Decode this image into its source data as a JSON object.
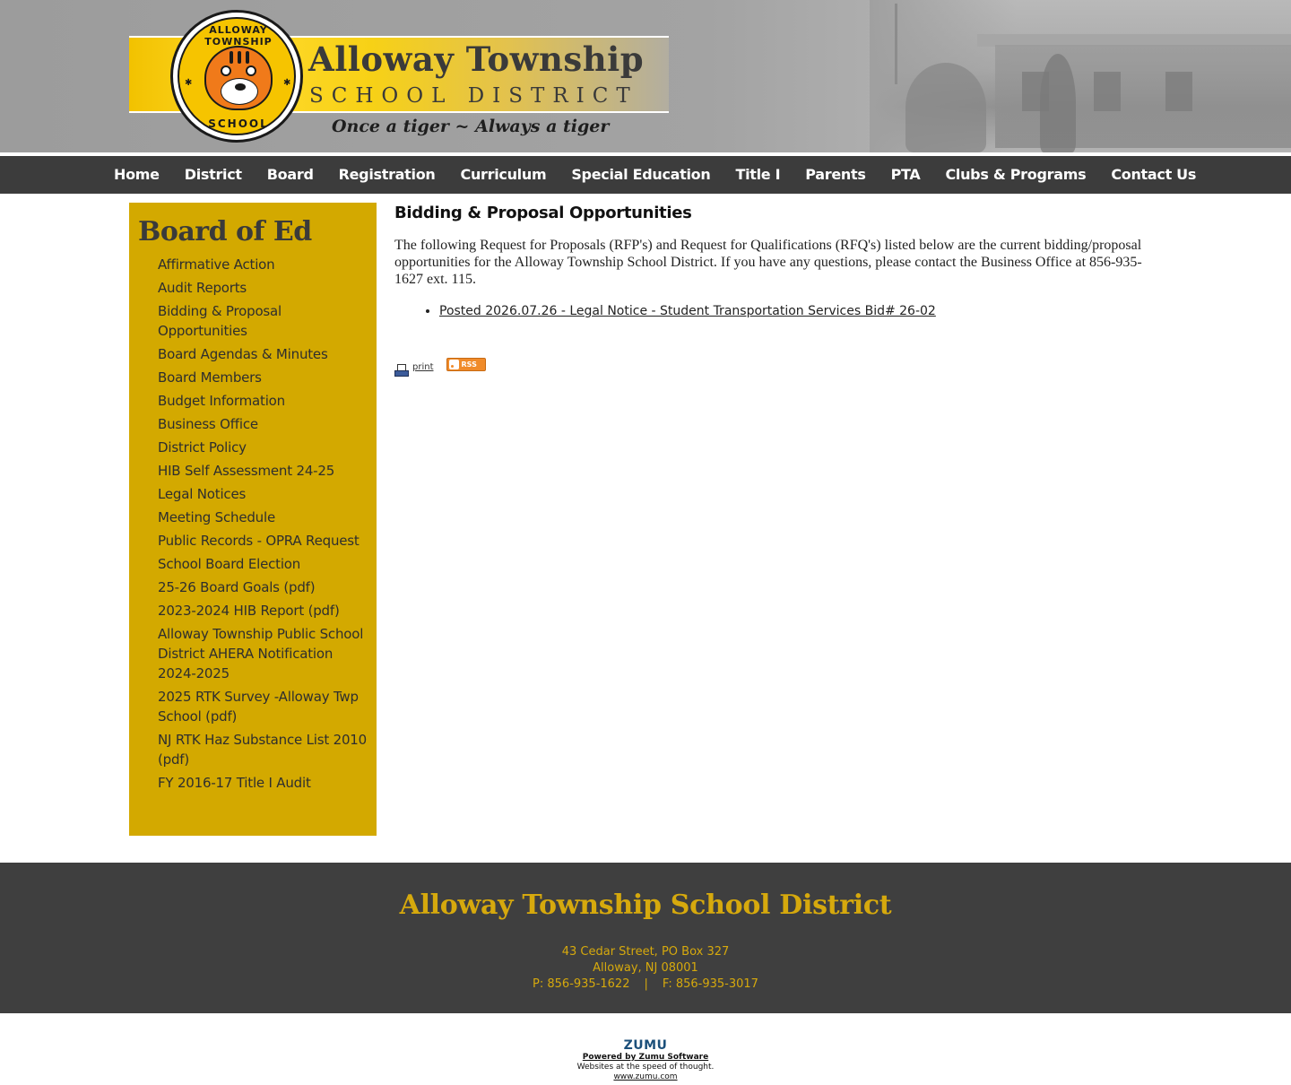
{
  "header": {
    "logo_top_text": "ALLOWAY TOWNSHIP",
    "logo_bottom_text": "SCHOOL",
    "title": "Alloway Township",
    "subtitle": "SCHOOL DISTRICT",
    "tagline": "Once a tiger ~ Always a tiger"
  },
  "nav": {
    "items": [
      {
        "label": "Home"
      },
      {
        "label": "District"
      },
      {
        "label": "Board"
      },
      {
        "label": "Registration"
      },
      {
        "label": "Curriculum"
      },
      {
        "label": "Special Education"
      },
      {
        "label": "Title I"
      },
      {
        "label": "Parents"
      },
      {
        "label": "PTA"
      },
      {
        "label": "Clubs & Programs"
      },
      {
        "label": "Contact Us"
      }
    ]
  },
  "sidebar": {
    "title": "Board of Ed",
    "items": [
      {
        "label": "Affirmative Action"
      },
      {
        "label": "Audit Reports"
      },
      {
        "label": "Bidding & Proposal Opportunities"
      },
      {
        "label": "Board Agendas & Minutes"
      },
      {
        "label": "Board Members"
      },
      {
        "label": "Budget Information"
      },
      {
        "label": "Business Office"
      },
      {
        "label": "District Policy"
      },
      {
        "label": "HIB Self Assessment 24-25"
      },
      {
        "label": "Legal Notices"
      },
      {
        "label": "Meeting Schedule"
      },
      {
        "label": "Public Records - OPRA Request"
      },
      {
        "label": "School Board Election"
      },
      {
        "label": "25-26 Board Goals (pdf)"
      },
      {
        "label": "2023-2024 HIB Report (pdf)"
      },
      {
        "label": "Alloway Township Public School District AHERA Notification 2024-2025"
      },
      {
        "label": "2025 RTK Survey -Alloway Twp School (pdf)"
      },
      {
        "label": "NJ RTK Haz Substance List 2010 (pdf)"
      },
      {
        "label": "FY 2016-17 Title I Audit"
      }
    ]
  },
  "content": {
    "title": "Bidding & Proposal Opportunities",
    "paragraph": "The following Request for Proposals (RFP's) and Request for Qualifications (RFQ's) listed below are the current bidding/proposal opportunities for the Alloway Township School District. If you have any questions, please contact the Business Office at 856-935-1627 ext. 115.",
    "links": [
      {
        "label": "Posted 2026.07.26 - Legal Notice - Student Transportation Services Bid# 26-02"
      }
    ],
    "print_label": "print",
    "rss_label": "RSS"
  },
  "footer": {
    "name": "Alloway Township School District",
    "address1": "43 Cedar Street, PO Box 327",
    "address2": "Alloway, NJ 08001",
    "phone": "P: 856-935-1622",
    "separator": "|",
    "fax": "F: 856-935-3017"
  },
  "powered": {
    "logo": "ZUMU",
    "link": "Powered by Zumu Software",
    "tagline": "Websites at the speed of thought.",
    "url": "www.zumu.com"
  },
  "colors": {
    "nav_bg": "#3c3c3c",
    "sidebar_bg": "#d3a900",
    "footer_bg": "#3f3f3f",
    "footer_text": "#d6a90d"
  }
}
